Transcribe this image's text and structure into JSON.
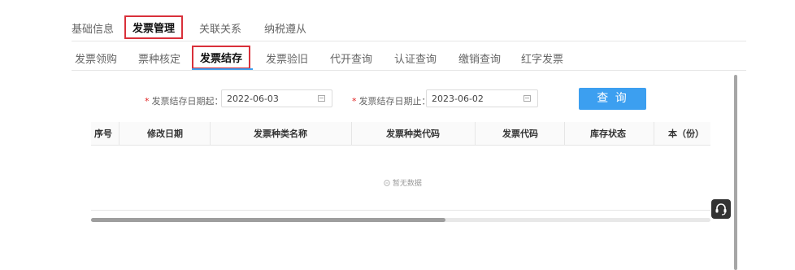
{
  "top_tabs": [
    {
      "label": "基础信息"
    },
    {
      "label": "发票管理"
    },
    {
      "label": "关联关系"
    },
    {
      "label": "纳税遵从"
    }
  ],
  "sub_tabs": [
    {
      "label": "发票领购"
    },
    {
      "label": "票种核定"
    },
    {
      "label": "发票结存"
    },
    {
      "label": "发票验旧"
    },
    {
      "label": "代开查询"
    },
    {
      "label": "认证查询"
    },
    {
      "label": "缴销查询"
    },
    {
      "label": "红字发票"
    }
  ],
  "filters": {
    "required_mark": "*",
    "start_label": "发票结存日期起：",
    "start_value": "2022-06-03",
    "end_label": "发票结存日期止：",
    "end_value": "2023-06-02",
    "query_button": "查 询"
  },
  "table": {
    "columns": [
      "序号",
      "修改日期",
      "发票种类名称",
      "发票种类代码",
      "发票代码",
      "库存状态",
      "本（份）"
    ],
    "empty_text": "暂无数据"
  },
  "colors": {
    "accent": "#3c9ff0",
    "highlight_border": "#d9303a",
    "required": "#e02020"
  },
  "icons": [
    "calendar-icon",
    "empty-icon",
    "customer-service-icon"
  ]
}
